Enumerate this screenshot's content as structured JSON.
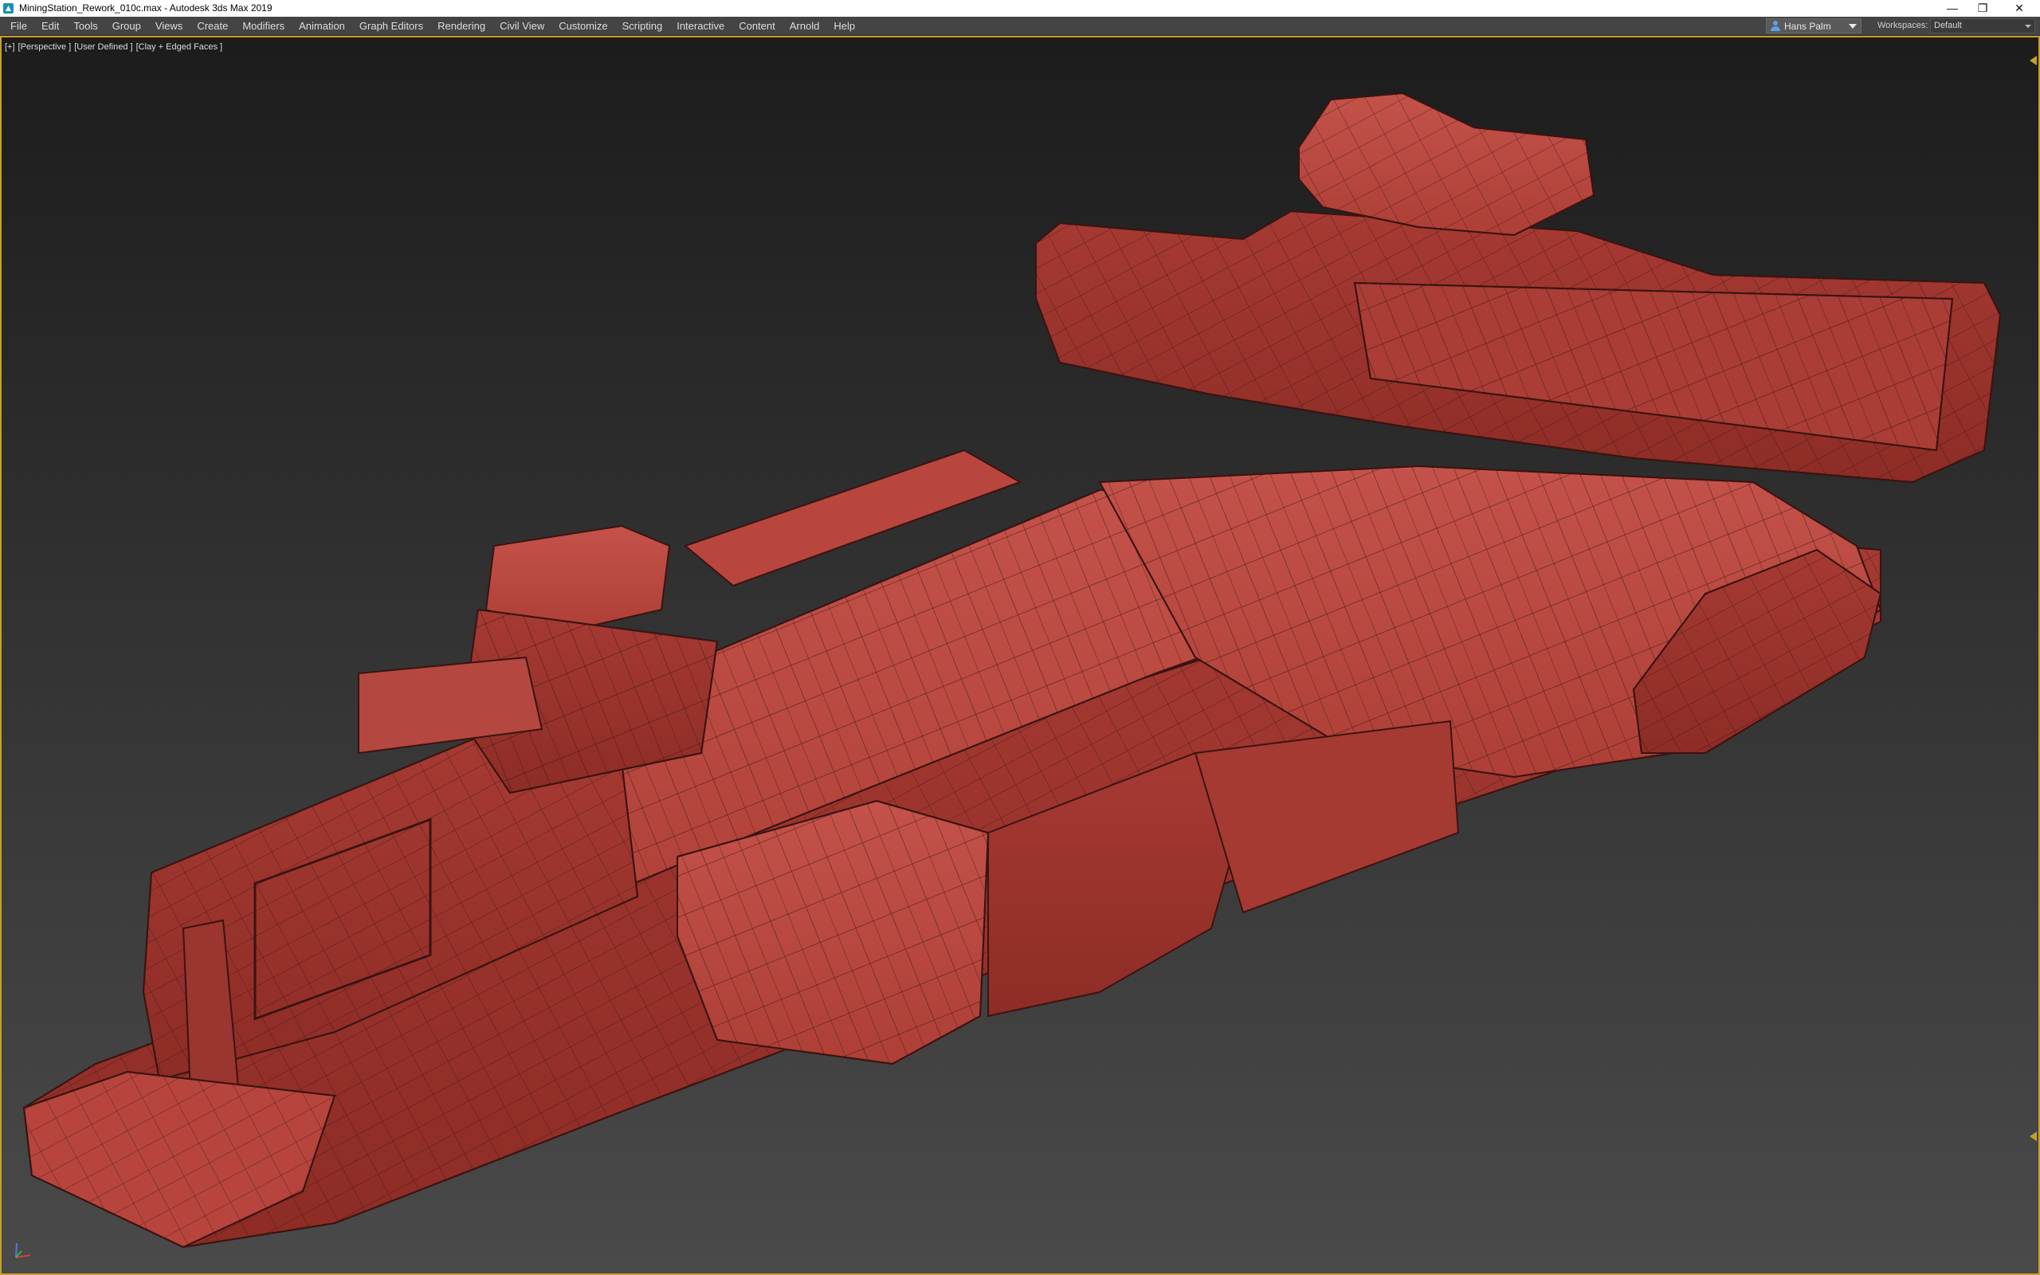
{
  "window": {
    "title": "MiningStation_Rework_010c.max - Autodesk 3ds Max 2019",
    "controls": {
      "minimize": "—",
      "restore": "❐",
      "close": "✕"
    }
  },
  "menu": {
    "items": [
      "File",
      "Edit",
      "Tools",
      "Group",
      "Views",
      "Create",
      "Modifiers",
      "Animation",
      "Graph Editors",
      "Rendering",
      "Civil View",
      "Customize",
      "Scripting",
      "Interactive",
      "Content",
      "Arnold",
      "Help"
    ]
  },
  "user": {
    "name": "Hans Palm",
    "icon": "user-icon"
  },
  "workspaces": {
    "label": "Workspaces:",
    "value": "Default"
  },
  "viewport": {
    "labels": [
      "[+]",
      "[Perspective ]",
      "[User Defined ]",
      "[Clay + Edged Faces ]"
    ],
    "border_color": "#c8a02a",
    "model_color": "#b5413a",
    "edge_color": "#3a1410"
  }
}
